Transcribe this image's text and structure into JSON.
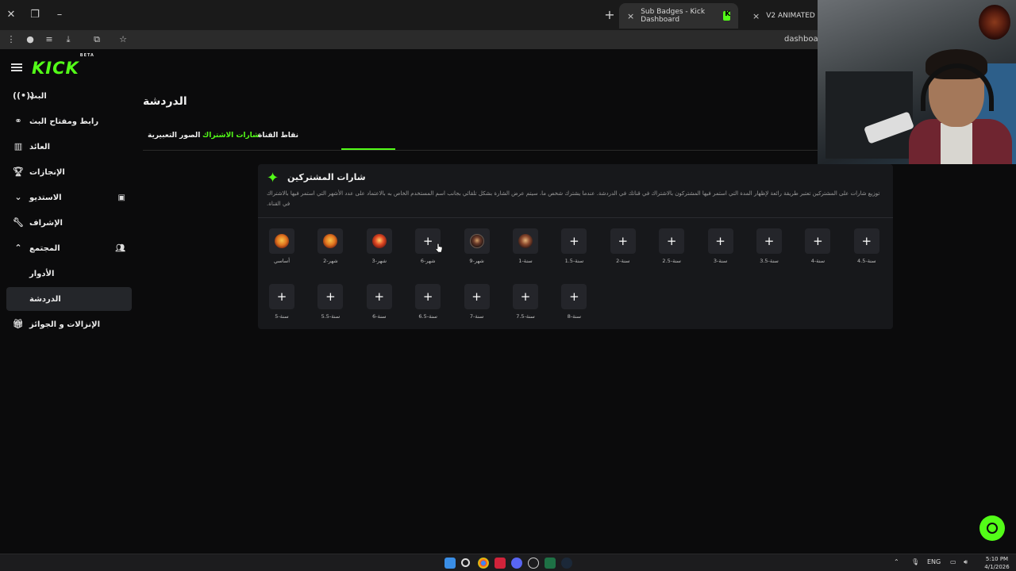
{
  "browser": {
    "tabs": [
      {
        "title": "Sub Badges - Kick Dashboard",
        "active": true
      },
      {
        "title": "V2 ANIMATED - Go",
        "active": false
      }
    ],
    "new_tab_symbol": "+",
    "close_symbol": "×",
    "url": "dashboard"
  },
  "sidebar": {
    "logo": "KICK",
    "logo_tag": "BETA",
    "items": [
      {
        "label": "البث",
        "icon": "live-icon"
      },
      {
        "label": "رابط ومفتاح البث",
        "icon": "link-icon"
      },
      {
        "label": "العائد",
        "icon": "chart-icon"
      },
      {
        "label": "الإنجازات",
        "icon": "trophy-icon"
      },
      {
        "label": "الاستديو",
        "icon": "studio-icon"
      },
      {
        "label": "الإشراف",
        "icon": "wrench-icon"
      },
      {
        "label": "المجتمع",
        "icon": "community-icon"
      },
      {
        "label": "الأدوار",
        "icon": ""
      },
      {
        "label": "الدردشة",
        "icon": ""
      },
      {
        "label": "الإنزالات و الجوائز",
        "icon": "gift-icon"
      }
    ],
    "active_item": "الدردشة"
  },
  "main": {
    "title": "الدردشة",
    "tabs": [
      {
        "label": "الصور التعبيرية",
        "active": false
      },
      {
        "label": "شارات الاشتراك",
        "active": true
      },
      {
        "label": "نقاط القناة",
        "active": false
      }
    ]
  },
  "badges_card": {
    "title": "شارات المشتركين",
    "description": "توزيع شارات على المشتركين تعتبر طريقة رائعة لإظهار المدة التي استمر فيها المشتركون بالاشتراك في قناتك في الدردشة. عندما يشترك شخص ما، سيتم عرض الشارة بشكل تلقائي بجانب اسم المستخدم الخاص به بالاعتماد على عدد الأشهر التي استمر فيها بالاشتراك في القناة.",
    "add_symbol": "+",
    "badges_row1": [
      {
        "label": "أساسي",
        "image": "fire-emblem"
      },
      {
        "label": "شهر-2",
        "image": "fire-emblem"
      },
      {
        "label": "شهر-3",
        "image": "red-emblem"
      },
      {
        "label": "شهر-6",
        "image": ""
      },
      {
        "label": "شهر-9",
        "image": "dark-emblem"
      },
      {
        "label": "سنة-1",
        "image": "bronze-emblem"
      },
      {
        "label": "سنة-1.5",
        "image": ""
      },
      {
        "label": "سنة-2",
        "image": ""
      },
      {
        "label": "سنة-2.5",
        "image": ""
      },
      {
        "label": "سنة-3",
        "image": ""
      },
      {
        "label": "سنة-3.5",
        "image": ""
      },
      {
        "label": "سنة-4",
        "image": ""
      },
      {
        "label": "سنة-4.5",
        "image": ""
      }
    ],
    "badges_row2": [
      {
        "label": "سنة-5",
        "image": ""
      },
      {
        "label": "سنة-5.5",
        "image": ""
      },
      {
        "label": "سنة-6",
        "image": ""
      },
      {
        "label": "سنة-6.5",
        "image": ""
      },
      {
        "label": "سنة-7",
        "image": ""
      },
      {
        "label": "سنة-7.5",
        "image": ""
      },
      {
        "label": "سنة-8",
        "image": ""
      }
    ]
  },
  "taskbar": {
    "language": "ENG",
    "time": "5:10 PM",
    "date": "4/1/2026"
  },
  "colors": {
    "accent": "#53fc18",
    "background": "#0b0b0c",
    "card": "#17181b",
    "tile": "#24252a"
  }
}
